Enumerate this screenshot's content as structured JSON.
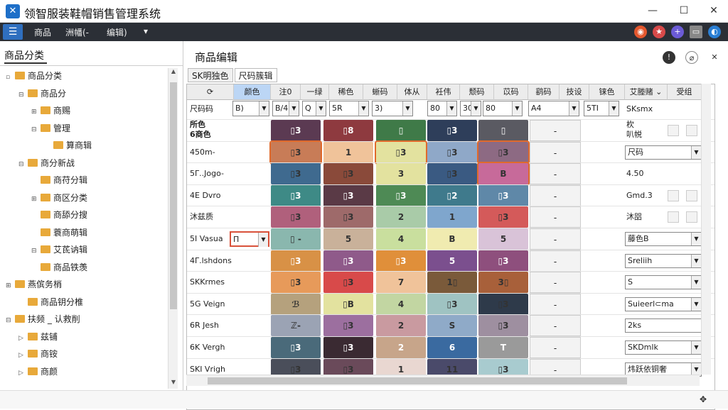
{
  "app": {
    "title": "领智服装鞋帽销售管理系统",
    "logo_icon": "logo-icon"
  },
  "window": {
    "minimize": "—",
    "maximize": "☐",
    "close": "✕"
  },
  "menubar": {
    "menu_icon": "☰",
    "items": [
      "商品",
      "洲幡(-",
      "编辑)"
    ],
    "more": "▾"
  },
  "left": {
    "title": "商品分类",
    "tree": [
      {
        "label": "商品分类",
        "level": 0,
        "exp": "▫"
      },
      {
        "label": "商品分",
        "level": 1,
        "exp": "⊟"
      },
      {
        "label": "商赐",
        "level": 2,
        "exp": "⊞"
      },
      {
        "label": "管理",
        "level": 2,
        "exp": "⊟"
      },
      {
        "label": "算商辑",
        "level": 3,
        "exp": ""
      },
      {
        "label": "商分新战",
        "level": 1,
        "exp": "⊟"
      },
      {
        "label": "商苻分辑",
        "level": 2,
        "exp": ""
      },
      {
        "label": "商区分类",
        "level": 2,
        "exp": "⊞"
      },
      {
        "label": "商舔分搜",
        "level": 2,
        "exp": ""
      },
      {
        "label": "蓑商萌辑",
        "level": 2,
        "exp": ""
      },
      {
        "label": "艾茋讷辑",
        "level": 2,
        "exp": "⊟"
      },
      {
        "label": "商品铁羡",
        "level": 2,
        "exp": ""
      },
      {
        "label": "燕傧务梢",
        "level": 0,
        "exp": "⊞"
      },
      {
        "label": "商品钥分椎",
        "level": 1,
        "exp": ""
      },
      {
        "label": "扶频 _ 认救削",
        "level": 0,
        "exp": "⊟"
      },
      {
        "label": "兹铺",
        "level": 1,
        "exp": "▷"
      },
      {
        "label": "商铵",
        "level": 1,
        "exp": "▷"
      },
      {
        "label": "商颜",
        "level": 1,
        "exp": "▷"
      }
    ]
  },
  "main": {
    "title": "商品编辑",
    "subtabs": [
      "SK明独色",
      "尺码簇辑"
    ],
    "columns": [
      "颜色",
      "注0",
      "一绿",
      "稀色",
      "蜥码",
      "体从",
      "衽伟",
      "颓码",
      "苡码",
      "鹞码",
      "技设",
      "铼色",
      "艾塍赌 ⌄",
      "受组"
    ],
    "filter_label": "尺码码",
    "filters": [
      "B)",
      "B/4",
      "Q",
      "5R",
      "3)",
      "80",
      "30",
      "80",
      "A4",
      "5TI"
    ],
    "filter_right": "SKsmx",
    "rows": [
      {
        "label": "所色\n6商色",
        "cells": [
          "▯3",
          "▯8",
          "▯",
          "▯3",
          "▯"
        ],
        "right": "杴\n叭帨",
        "right_kind": "text",
        "checks": true
      },
      {
        "label": "450m-",
        "cells": [
          "▯3",
          "1",
          "▯3",
          "▯3",
          "▯3"
        ],
        "right": "尺码",
        "right_kind": "select"
      },
      {
        "label": "5Γ..Jogo-",
        "cells": [
          "▯3",
          "▯3",
          "3",
          "▯3",
          "B"
        ],
        "right": "4.50",
        "right_kind": "text"
      },
      {
        "label": "4E Dvro",
        "cells": [
          "▯3",
          "▯3",
          "▯3",
          "▯2",
          "▯3"
        ],
        "right": "Gmd.3",
        "right_kind": "text",
        "checks": true
      },
      {
        "label": "沐兹质",
        "cells": [
          "▯3",
          "▯3",
          "2",
          "1",
          "▯3"
        ],
        "right": "沐㗊",
        "right_kind": "text",
        "checks": true
      },
      {
        "label": "5I Vasua",
        "cells": [
          "▯ -",
          "5",
          "4",
          "B",
          "5"
        ],
        "right": "藤色B",
        "right_kind": "select",
        "left_select": "Π"
      },
      {
        "label": "4Γ.lshdons",
        "cells": [
          "▯3",
          "▯3",
          "▯3",
          "5",
          "▯3"
        ],
        "right": "Sreliih",
        "right_kind": "select2"
      },
      {
        "label": "SKKrmes",
        "cells": [
          "▯3",
          "▯3",
          "7",
          "1▯",
          "3▯"
        ],
        "right": "S",
        "right_kind": "select"
      },
      {
        "label": "5G Veign",
        "cells": [
          "ℬ",
          "▯B",
          "4",
          "▯3",
          "▯3"
        ],
        "right": "Suieerl⊂ma",
        "right_kind": "select"
      },
      {
        "label": "6R Jesh",
        "cells": [
          "ℤ-",
          "▯3",
          "2",
          "S",
          "▯3"
        ],
        "right": "2ks",
        "right_kind": "input"
      },
      {
        "label": "6K Vergh",
        "cells": [
          "▯3",
          "▯3",
          "2",
          "6",
          "T"
        ],
        "right": "SKDmlk",
        "right_kind": "select"
      },
      {
        "label": "SKI Vrigh",
        "cells": [
          "▯3",
          "▯3",
          "1",
          "11",
          "▯3"
        ],
        "right": "炜跃依铜奢",
        "right_kind": "select2"
      }
    ],
    "dash": "-"
  },
  "colors": {
    "rows": [
      [
        "#5b3a52",
        "#8e3a3f",
        "#3f7a48",
        "#2e3e5a",
        "#5a5a62"
      ],
      [
        "#c87c57",
        "#f0c39a",
        "#e3e29f",
        "#8fa8c8",
        "#8d6a83"
      ],
      [
        "#3f6a8f",
        "#8a4a3a",
        "#e3e29f",
        "#3a5a82",
        "#c76a9a"
      ],
      [
        "#3e8a86",
        "#5a3a46",
        "#4e8a55",
        "#3f7a8c",
        "#5f88a8"
      ],
      [
        "#b0607c",
        "#9e6a6a",
        "#a9cba8",
        "#7fa6cd",
        "#d45a5a"
      ],
      [
        "#8ab7ae",
        "#c9b19a",
        "#c9df9e",
        "#f0ebb0",
        "#d9c3d8"
      ],
      [
        "#d89146",
        "#8f5a8a",
        "#e08f3a",
        "#7b4f8e",
        "#8e4f7d"
      ],
      [
        "#e79a5a",
        "#d84a4a",
        "#f0c39a",
        "#7a5a3a",
        "#a8603a"
      ],
      [
        "#b5a17d",
        "#e3e29f",
        "#c2d6a2",
        "#9fc3c2",
        "#2e3a4a"
      ],
      [
        "#9ba3b4",
        "#9c6f9f",
        "#c99aa0",
        "#8faac8",
        "#9e8fa0"
      ],
      [
        "#4a6a7a",
        "#3a2a32",
        "#c7a58a",
        "#3a6aa0",
        "#9a9a9a"
      ],
      [
        "#4a4e5a",
        "#6a4a5a",
        "#e9d7d1",
        "#4a4a6a",
        "#a8cbcf"
      ]
    ],
    "light_rows": [
      1,
      2,
      4,
      5,
      7,
      8,
      9,
      11
    ]
  },
  "status": {
    "icon": "✥",
    "resize": "⌟"
  }
}
